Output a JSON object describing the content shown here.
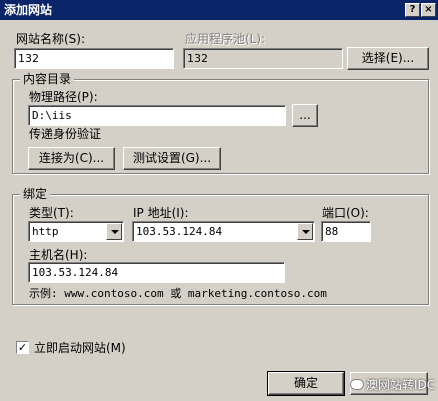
{
  "window": {
    "title": "添加网站",
    "help_glyph": "?",
    "close_glyph": "×"
  },
  "site": {
    "name_label": "网站名称(S):",
    "name_value": "132",
    "pool_label": "应用程序池(L):",
    "pool_value": "132",
    "select_button": "选择(E)..."
  },
  "content": {
    "group_label": "内容目录",
    "path_label": "物理路径(P):",
    "path_value": "D:\\iis",
    "browse_button": "...",
    "auth_label": "传递身份验证",
    "connect_button": "连接为(C)...",
    "test_button": "测试设置(G)..."
  },
  "binding": {
    "group_label": "绑定",
    "type_label": "类型(T):",
    "type_value": "http",
    "ip_label": "IP 地址(I):",
    "ip_value": "103.53.124.84",
    "port_label": "端口(O):",
    "port_value": "88",
    "host_label": "主机名(H):",
    "host_value": "103.53.124.84",
    "example_text": "示例: www.contoso.com 或 marketing.contoso.com"
  },
  "start": {
    "checkbox_label": "立即启动网站(M)",
    "checked": true,
    "check_glyph": "✓"
  },
  "footer": {
    "ok_button": "确定",
    "watermark_text": "澳网站转IDC"
  }
}
